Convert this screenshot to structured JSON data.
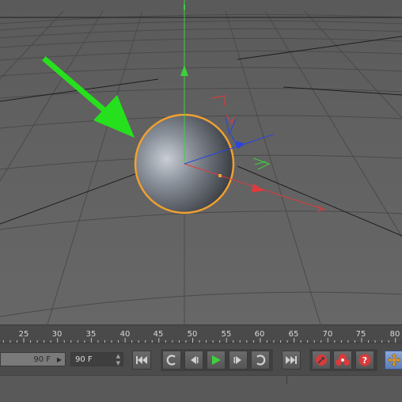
{
  "timeline": {
    "ticks": [
      "25",
      "30",
      "35",
      "40",
      "45",
      "50",
      "55",
      "60",
      "65",
      "70",
      "75",
      "80"
    ]
  },
  "controls": {
    "end_frame_left": "90 F",
    "end_frame": "90 F"
  },
  "colors": {
    "x_axis": "#e23a3a",
    "y_axis": "#3cd13c",
    "z_axis": "#2b43e0",
    "selection_outline": "#f0a030",
    "annotation_arrow": "#27e01d",
    "record_button": "#d93a3a",
    "play_button": "#3cd13c"
  },
  "icons": {
    "go_to_start": "skip-to-start-icon",
    "loop_back": "loop-back-icon",
    "step_back": "step-back-icon",
    "play": "play-icon",
    "step_forward": "step-forward-icon",
    "loop_forward": "loop-forward-icon",
    "go_to_end": "skip-to-end-icon",
    "record": "record-keyframe-icon",
    "autokey": "autokey-icon",
    "help": "help-icon",
    "move_tool": "move-tool-icon"
  }
}
